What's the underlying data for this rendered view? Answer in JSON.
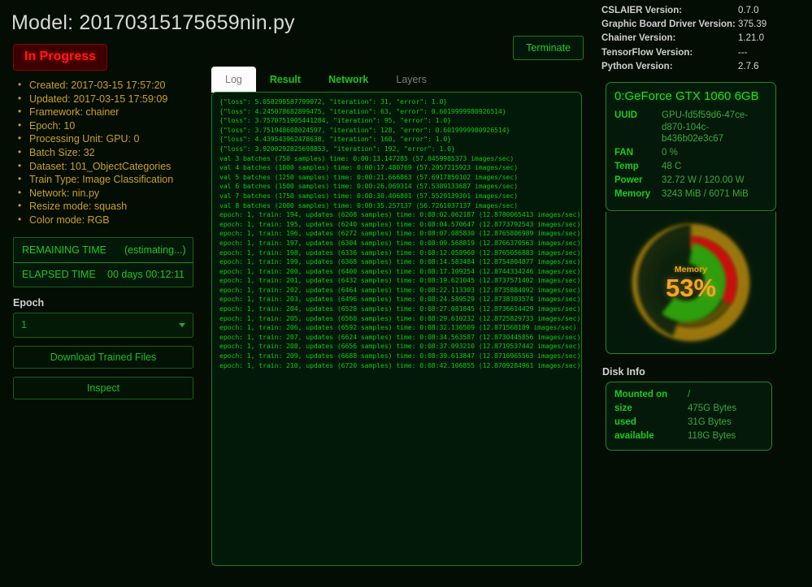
{
  "model": {
    "title": "Model: 20170315175659nin.py",
    "status": "In Progress",
    "meta": [
      "Created: 2017-03-15 17:57:20",
      "Updated: 2017-03-15 17:59:09",
      "Framework: chainer",
      "Epoch: 10",
      "Processing Unit: GPU: 0",
      "Batch Size: 32",
      "Dataset: 101_ObjectCategories",
      "Train Type: Image Classification",
      "Network: nin.py",
      "Resize mode: squash",
      "Color mode: RGB"
    ]
  },
  "timing": {
    "remaining_label": "REMAINING TIME",
    "remaining_value": "(estimating...)",
    "elapsed_label": "ELAPSED TIME",
    "elapsed_value": "00 days 00:12:11"
  },
  "controls": {
    "epoch_label": "Epoch",
    "epoch_value": "1",
    "download_label": "Download Trained Files",
    "inspect_label": "Inspect",
    "terminate_label": "Terminate"
  },
  "tabs": [
    {
      "label": "Log",
      "state": "active"
    },
    {
      "label": "Result",
      "state": "link"
    },
    {
      "label": "Network",
      "state": "link"
    },
    {
      "label": "Layers",
      "state": "disabled"
    }
  ],
  "log_lines": [
    "{\"loss\": 5.058298587799072, \"iteration\": 31, \"error\": 1.0}",
    "{\"loss\": 4.245078682899475, \"iteration\": 63, \"error\": 0.6019999980926514}",
    "{\"loss\": 3.7570751905441284, \"iteration\": 95, \"error\": 1.0}",
    "{\"loss\": 3.751948608024597, \"iteration\": 128, \"error\": 0.6019999980926514}",
    "{\"loss\": 4.439543962478638, \"iteration\": 160, \"error\": 1.0}",
    "{\"loss\": 3.9200292825698853, \"iteration\": 192, \"error\": 1.0}",
    "val 3 batches (750 samples) time: 0:00:13.147285 (57.0459985373 images/sec)",
    "val 4 batches (1000 samples) time: 0:00:17.480769 (57.2057215923 images/sec)",
    "val 5 batches (1250 samples) time: 0:00:21.666863 (57.6917850102 images/sec)",
    "val 6 batches (1500 samples) time: 0:00:26.069314 (57.5389133687 images/sec)",
    "val 7 batches (1750 samples) time: 0:00:30.406801 (57.5529139301 images/sec)",
    "val 8 batches (2000 samples) time: 0:00:35.257137 (56.7261037137 images/sec)",
    "epoch: 1, train: 194, updates (6208 samples) time: 0:08:02.062187 (12.8780065413 images/sec)",
    "epoch: 1, train: 195, updates (6240 samples) time: 0:08:04.570647 (12.8773792543 images/sec)",
    "epoch: 1, train: 196, updates (6272 samples) time: 0:08:07.085830 (12.8765806989 images/sec)",
    "epoch: 1, train: 197, updates (6304 samples) time: 0:08:09.568819 (12.8766370563 images/sec)",
    "epoch: 1, train: 198, updates (6336 samples) time: 0:08:12.058960 (12.8765056883 images/sec)",
    "epoch: 1, train: 199, updates (6368 samples) time: 0:08:14.583484 (12.8754804877 images/sec)",
    "epoch: 1, train: 200, updates (6400 samples) time: 0:08:17.109254 (12.8744334246 images/sec)",
    "epoch: 1, train: 201, updates (6432 samples) time: 0:08:19.621045 (12.8737571402 images/sec)",
    "epoch: 1, train: 202, updates (6464 samples) time: 0:08:22.113303 (12.8735884092 images/sec)",
    "epoch: 1, train: 203, updates (6496 samples) time: 0:08:24.589529 (12.8738303574 images/sec)",
    "epoch: 1, train: 204, updates (6528 samples) time: 0:08:27.081845 (12.8736614429 images/sec)",
    "epoch: 1, train: 205, updates (6560 samples) time: 0:08:29.610232 (12.8725829733 images/sec)",
    "epoch: 1, train: 206, updates (6592 samples) time: 0:08:32.136509 (12.871568189 images/sec)",
    "epoch: 1, train: 207, updates (6624 samples) time: 0:08:34.563587 (12.8730445856 images/sec)",
    "epoch: 1, train: 208, updates (6656 samples) time: 0:08:37.093210 (12.8719537442 images/sec)",
    "epoch: 1, train: 209, updates (6688 samples) time: 0:08:39.613847 (12.8710965563 images/sec)",
    "epoch: 1, train: 210, updates (6720 samples) time: 0:08:42.106855 (12.8709284961 images/sec)"
  ],
  "versions": [
    {
      "key": "CSLAIER Version:",
      "value": "0.7.0"
    },
    {
      "key": "Graphic Board Driver Version:",
      "value": "375.39"
    },
    {
      "key": "Chainer Version:",
      "value": "1.21.0"
    },
    {
      "key": "TensorFlow Version:",
      "value": "---"
    },
    {
      "key": "Python Version:",
      "value": "2.7.6"
    }
  ],
  "gpu": {
    "title": "0:GeForce GTX 1060 6GB",
    "rows": [
      {
        "key": "UUID",
        "value": "GPU-fd5f59d6-47ce-d870-104c-b436b02e3c67"
      },
      {
        "key": "FAN",
        "value": "0 %"
      },
      {
        "key": "Temp",
        "value": "48 C"
      },
      {
        "key": "Power",
        "value": "32.72 W / 120.00 W"
      },
      {
        "key": "Memory",
        "value": "3243 MiB / 6071 MiB"
      }
    ],
    "gauge": {
      "label": "Memory",
      "value": "53%",
      "percent": 53,
      "green": "#2f9e0f",
      "red": "#cc1010",
      "amber": "#c8920f"
    }
  },
  "disk": {
    "title": "Disk Info",
    "rows": [
      {
        "key": "Mounted on",
        "value": "/"
      },
      {
        "key": "size",
        "value": "475G Bytes"
      },
      {
        "key": "used",
        "value": "31G Bytes"
      },
      {
        "key": "available",
        "value": "118G Bytes"
      }
    ]
  },
  "colors": {
    "background": "#040d04",
    "panel": "#04190a",
    "green": "#1ecb1e",
    "amber": "#c8a02a",
    "red": "#ff1a1a"
  }
}
